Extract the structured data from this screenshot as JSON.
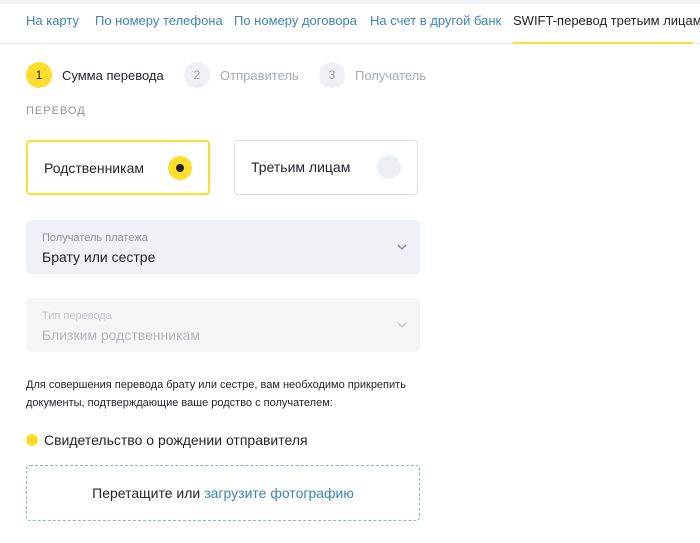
{
  "tabs": [
    {
      "label": "На карту"
    },
    {
      "label": "По номеру телефона"
    },
    {
      "label": "По номеру договора"
    },
    {
      "label": "На счет в другой банк"
    },
    {
      "label": "SWIFT-перевод третьим лицам",
      "active": true
    }
  ],
  "steps": [
    {
      "number": "1",
      "label": "Сумма перевода",
      "active": true
    },
    {
      "number": "2",
      "label": "Отправитель",
      "active": false
    },
    {
      "number": "3",
      "label": "Получатель",
      "active": false
    }
  ],
  "section_title": "ПЕРЕВОД",
  "transfer_type": {
    "options": [
      {
        "label": "Родственникам",
        "selected": true
      },
      {
        "label": "Третьим лицам",
        "selected": false
      }
    ]
  },
  "recipient_select": {
    "label": "Получатель платежа",
    "value": "Брату или сестре"
  },
  "transfer_kind_select": {
    "label": "Тип перевода",
    "value": "Близким родственникам",
    "disabled": true
  },
  "info_text": "Для совершения перевода брату или сестре, вам необходимо прикрепить документы, подтверждающие ваше родство с получателем:",
  "document": {
    "label": "Свидетельство о рождении отправителя"
  },
  "dropzone": {
    "text": "Перетащите или",
    "link": "загрузите фотографию"
  },
  "colors": {
    "accent": "#ffdd2d",
    "link": "#3f84b8",
    "text": "#1f2328",
    "select_bg": "#eef1f5"
  }
}
